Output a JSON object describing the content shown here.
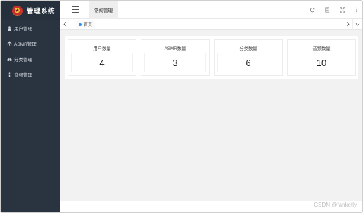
{
  "app": {
    "title": "管理系统",
    "logo_icon": "emblem-logo-icon"
  },
  "sidebar": {
    "items": [
      {
        "label": "用户管理",
        "icon": "user-icon"
      },
      {
        "label": "ASMR管理",
        "icon": "bank-icon"
      },
      {
        "label": "分类管理",
        "icon": "binoculars-icon"
      },
      {
        "label": "音频管理",
        "icon": "info-icon"
      }
    ]
  },
  "header": {
    "menu_tab": "常规管理",
    "tools": [
      "refresh-icon",
      "document-icon",
      "fullscreen-icon",
      "more-icon"
    ]
  },
  "tabs": {
    "items": [
      {
        "label": "首页"
      }
    ]
  },
  "stats": [
    {
      "title": "用户数量",
      "value": "4"
    },
    {
      "title": "ASMR数量",
      "value": "3"
    },
    {
      "title": "分类数量",
      "value": "6"
    },
    {
      "title": "音频数量",
      "value": "10"
    }
  ],
  "watermark": "CSDN @fanketly",
  "colors": {
    "sidebar_bg": "#2a3441",
    "accent": "#2d8cf0",
    "content_bg": "#f2f2f2"
  }
}
